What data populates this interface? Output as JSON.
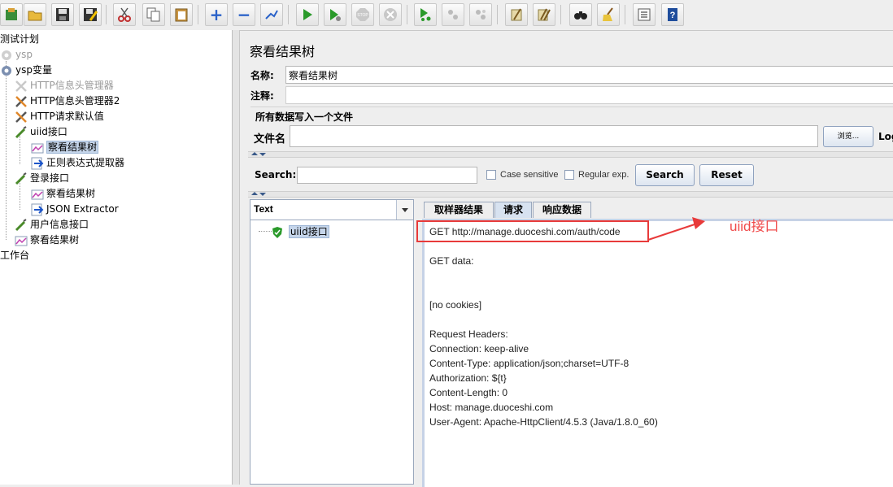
{
  "toolbar": {
    "buttons": [
      "template-icon",
      "open-icon",
      "save-icon",
      "save-as-icon",
      "cut-icon",
      "copy-icon",
      "paste-icon",
      "expand-icon",
      "collapse-icon",
      "toggle-icon",
      "start-icon",
      "start-no-pause-icon",
      "stop-icon",
      "shutdown-icon",
      "remote-start-icon",
      "remote-stop-icon",
      "remote-exit-icon",
      "clear-icon",
      "clear-all-icon",
      "search-binoculars-icon",
      "reset-search-broom-icon",
      "function-helper-icon",
      "help-icon"
    ],
    "stop_label": "STOP"
  },
  "tree": {
    "root": "测试计划",
    "items": [
      {
        "label": "ysp",
        "icon": "gear-icon"
      },
      {
        "label": "ysp变量",
        "icon": "gear-icon"
      },
      {
        "label": "HTTP信息头管理器",
        "icon": "wrench-icon"
      },
      {
        "label": "HTTP信息头管理器2",
        "icon": "wrench-icon"
      },
      {
        "label": "HTTP请求默认值",
        "icon": "wrench-icon"
      },
      {
        "label": "uiid接口",
        "icon": "pipette-icon"
      },
      {
        "label": "察看结果树",
        "icon": "graph-icon"
      },
      {
        "label": "正则表达式提取器",
        "icon": "arrow-icon"
      },
      {
        "label": "登录接口",
        "icon": "pipette-icon"
      },
      {
        "label": "察看结果树",
        "icon": "graph-icon"
      },
      {
        "label": "JSON Extractor",
        "icon": "arrow-icon"
      },
      {
        "label": "用户信息接口",
        "icon": "pipette-icon"
      },
      {
        "label": "察看结果树",
        "icon": "graph-icon"
      }
    ],
    "workbench": "工作台"
  },
  "panel": {
    "title": "察看结果树",
    "name_label": "名称:",
    "name_value": "察看结果树",
    "comment_label": "注释:",
    "comment_value": "",
    "file_group": "所有数据写入一个文件",
    "filename_label": "文件名",
    "filename_value": "",
    "browse_label": "浏览...",
    "log_label": "Log"
  },
  "search": {
    "label": "Search:",
    "value": "",
    "case_sensitive": "Case sensitive",
    "regex": "Regular exp.",
    "search_button": "Search",
    "reset_button": "Reset"
  },
  "results": {
    "renderer": "Text",
    "sample": "uiid接口",
    "tabs": [
      "取样器结果",
      "请求",
      "响应数据"
    ],
    "active_tab": "请求",
    "lines": [
      "GET http://manage.duoceshi.com/auth/code",
      "",
      "GET data:",
      "",
      "",
      "[no cookies]",
      "",
      "Request Headers:",
      "Connection: keep-alive",
      "Content-Type: application/json;charset=UTF-8",
      "Authorization: ${t}",
      "Content-Length: 0",
      "Host: manage.duoceshi.com",
      "User-Agent: Apache-HttpClient/4.5.3 (Java/1.8.0_60)"
    ]
  },
  "annotation": {
    "text": "uiid接口",
    "color": "#e83a3a"
  }
}
